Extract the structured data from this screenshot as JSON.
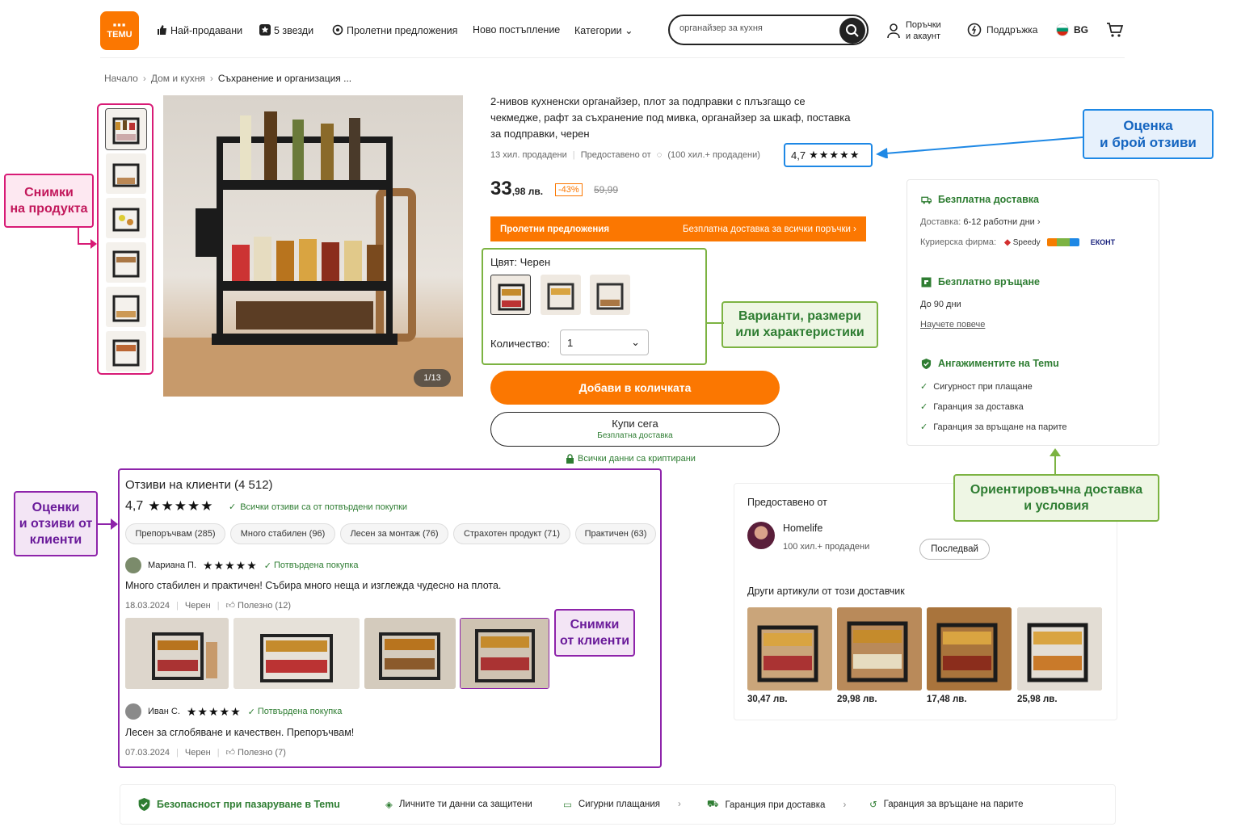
{
  "header": {
    "logo_text": "TEMU",
    "nav": [
      "Най-продавани",
      "5 звезди",
      "Пролетни предложения",
      "Ново постъпление",
      "Категории"
    ],
    "search_value": "органайзер за кухня",
    "orders_line1": "Поръчки",
    "orders_line2": "и акаунт",
    "support": "Поддръжка",
    "lang": "BG"
  },
  "breadcrumb": [
    "Начало",
    "Дом и кухня",
    "Съхранение и организация ..."
  ],
  "gallery": {
    "counter": "1/13"
  },
  "product": {
    "title": "2-нивов кухненски органайзер, плот за подправки с плъзгащо се чекмедже, рафт за съхранение под мивка, органайзер за шкаф, поставка за подправки, черен",
    "sold": "13 хил. продадени",
    "provided_by": "Предоставено от",
    "seller_sales": "(100 хил.+ продадени)",
    "rating": "4,7",
    "price_main": "33",
    "price_cents": ",98 лв.",
    "discount": "-43%",
    "old_price": "59,99",
    "promo_left": "Пролетни предложения",
    "promo_right": "Безплатна доставка за всички поръчки",
    "color_label": "Цвят: Черен",
    "qty_label": "Количество:",
    "qty_value": "1",
    "add_to_cart": "Добави в количката",
    "buy_now": "Купи сега",
    "buy_now_sub": "Безплатна доставка",
    "secure_note": "Всички данни са криптирани"
  },
  "shipping": {
    "free_delivery": "Безплатна доставка",
    "delivery_label": "Доставка:",
    "delivery_value": "6-12 работни дни",
    "courier_label": "Куриерска фирма:",
    "couriers": [
      "Speedy",
      "ЕКОНТ"
    ],
    "free_return": "Безплатно връщане",
    "return_days": "До 90 дни",
    "learn_more": "Научете повече",
    "commitments": "Ангажиментите на Temu",
    "c1": "Сигурност при плащане",
    "c2": "Гаранция за доставка",
    "c3": "Гаранция за връщане на парите"
  },
  "reviews": {
    "title": "Отзиви на клиенти (4 512)",
    "score": "4,7",
    "verified_all": "Всички отзиви са от потвърдени покупки",
    "chips": [
      "Препоръчвам (285)",
      "Много стабилен (96)",
      "Лесен за монтаж (76)",
      "Страхотен продукт (71)",
      "Практичен (63)"
    ],
    "items": [
      {
        "name": "Мариана П.",
        "verified": "Потвърдена покупка",
        "text": "Много стабилен и практичен! Събира много неща и изглежда чудесно на плота.",
        "date": "18.03.2024",
        "color": "Черен",
        "helpful": "Полезно (12)"
      },
      {
        "name": "Иван С.",
        "verified": "Потвърдена покупка",
        "text": "Лесен за сглобяване и качествен. Препоръчвам!",
        "date": "07.03.2024",
        "color": "Черен",
        "helpful": "Полезно (7)"
      }
    ]
  },
  "seller": {
    "label": "Предоставено от",
    "name": "Homelife",
    "sales": "100 хил.+ продадени",
    "follow": "Последвай",
    "others": "Други артикули от този доставчик",
    "prices": [
      "30,47 лв.",
      "29,98 лв.",
      "17,48 лв.",
      "25,98 лв."
    ]
  },
  "footer": {
    "title": "Безопасност при пазаруване в Temu",
    "items": [
      "Личните ти данни са защитени",
      "Сигурни плащания",
      "Гаранция при доставка",
      "Гаранция за връщане на парите"
    ]
  },
  "annotations": {
    "photos_l1": "Снимки",
    "photos_l2": "на продукта",
    "rating_l1": "Оценка",
    "rating_l2": "и брой отзиви",
    "variants_l1": "Варианти, размери",
    "variants_l2": "или характеристики",
    "delivery_l1": "Ориентировъчна доставка",
    "delivery_l2": "и условия",
    "reviews_l1": "Оценки",
    "reviews_l2": "и отзиви от",
    "reviews_l3": "клиенти",
    "custphotos_l1": "Снимки",
    "custphotos_l2": "от клиенти"
  },
  "colors": {
    "accent": "#fb7701",
    "green": "#2e7d32",
    "pink": "#d81b76",
    "purple": "#8e24aa",
    "blue": "#1e88e5"
  }
}
